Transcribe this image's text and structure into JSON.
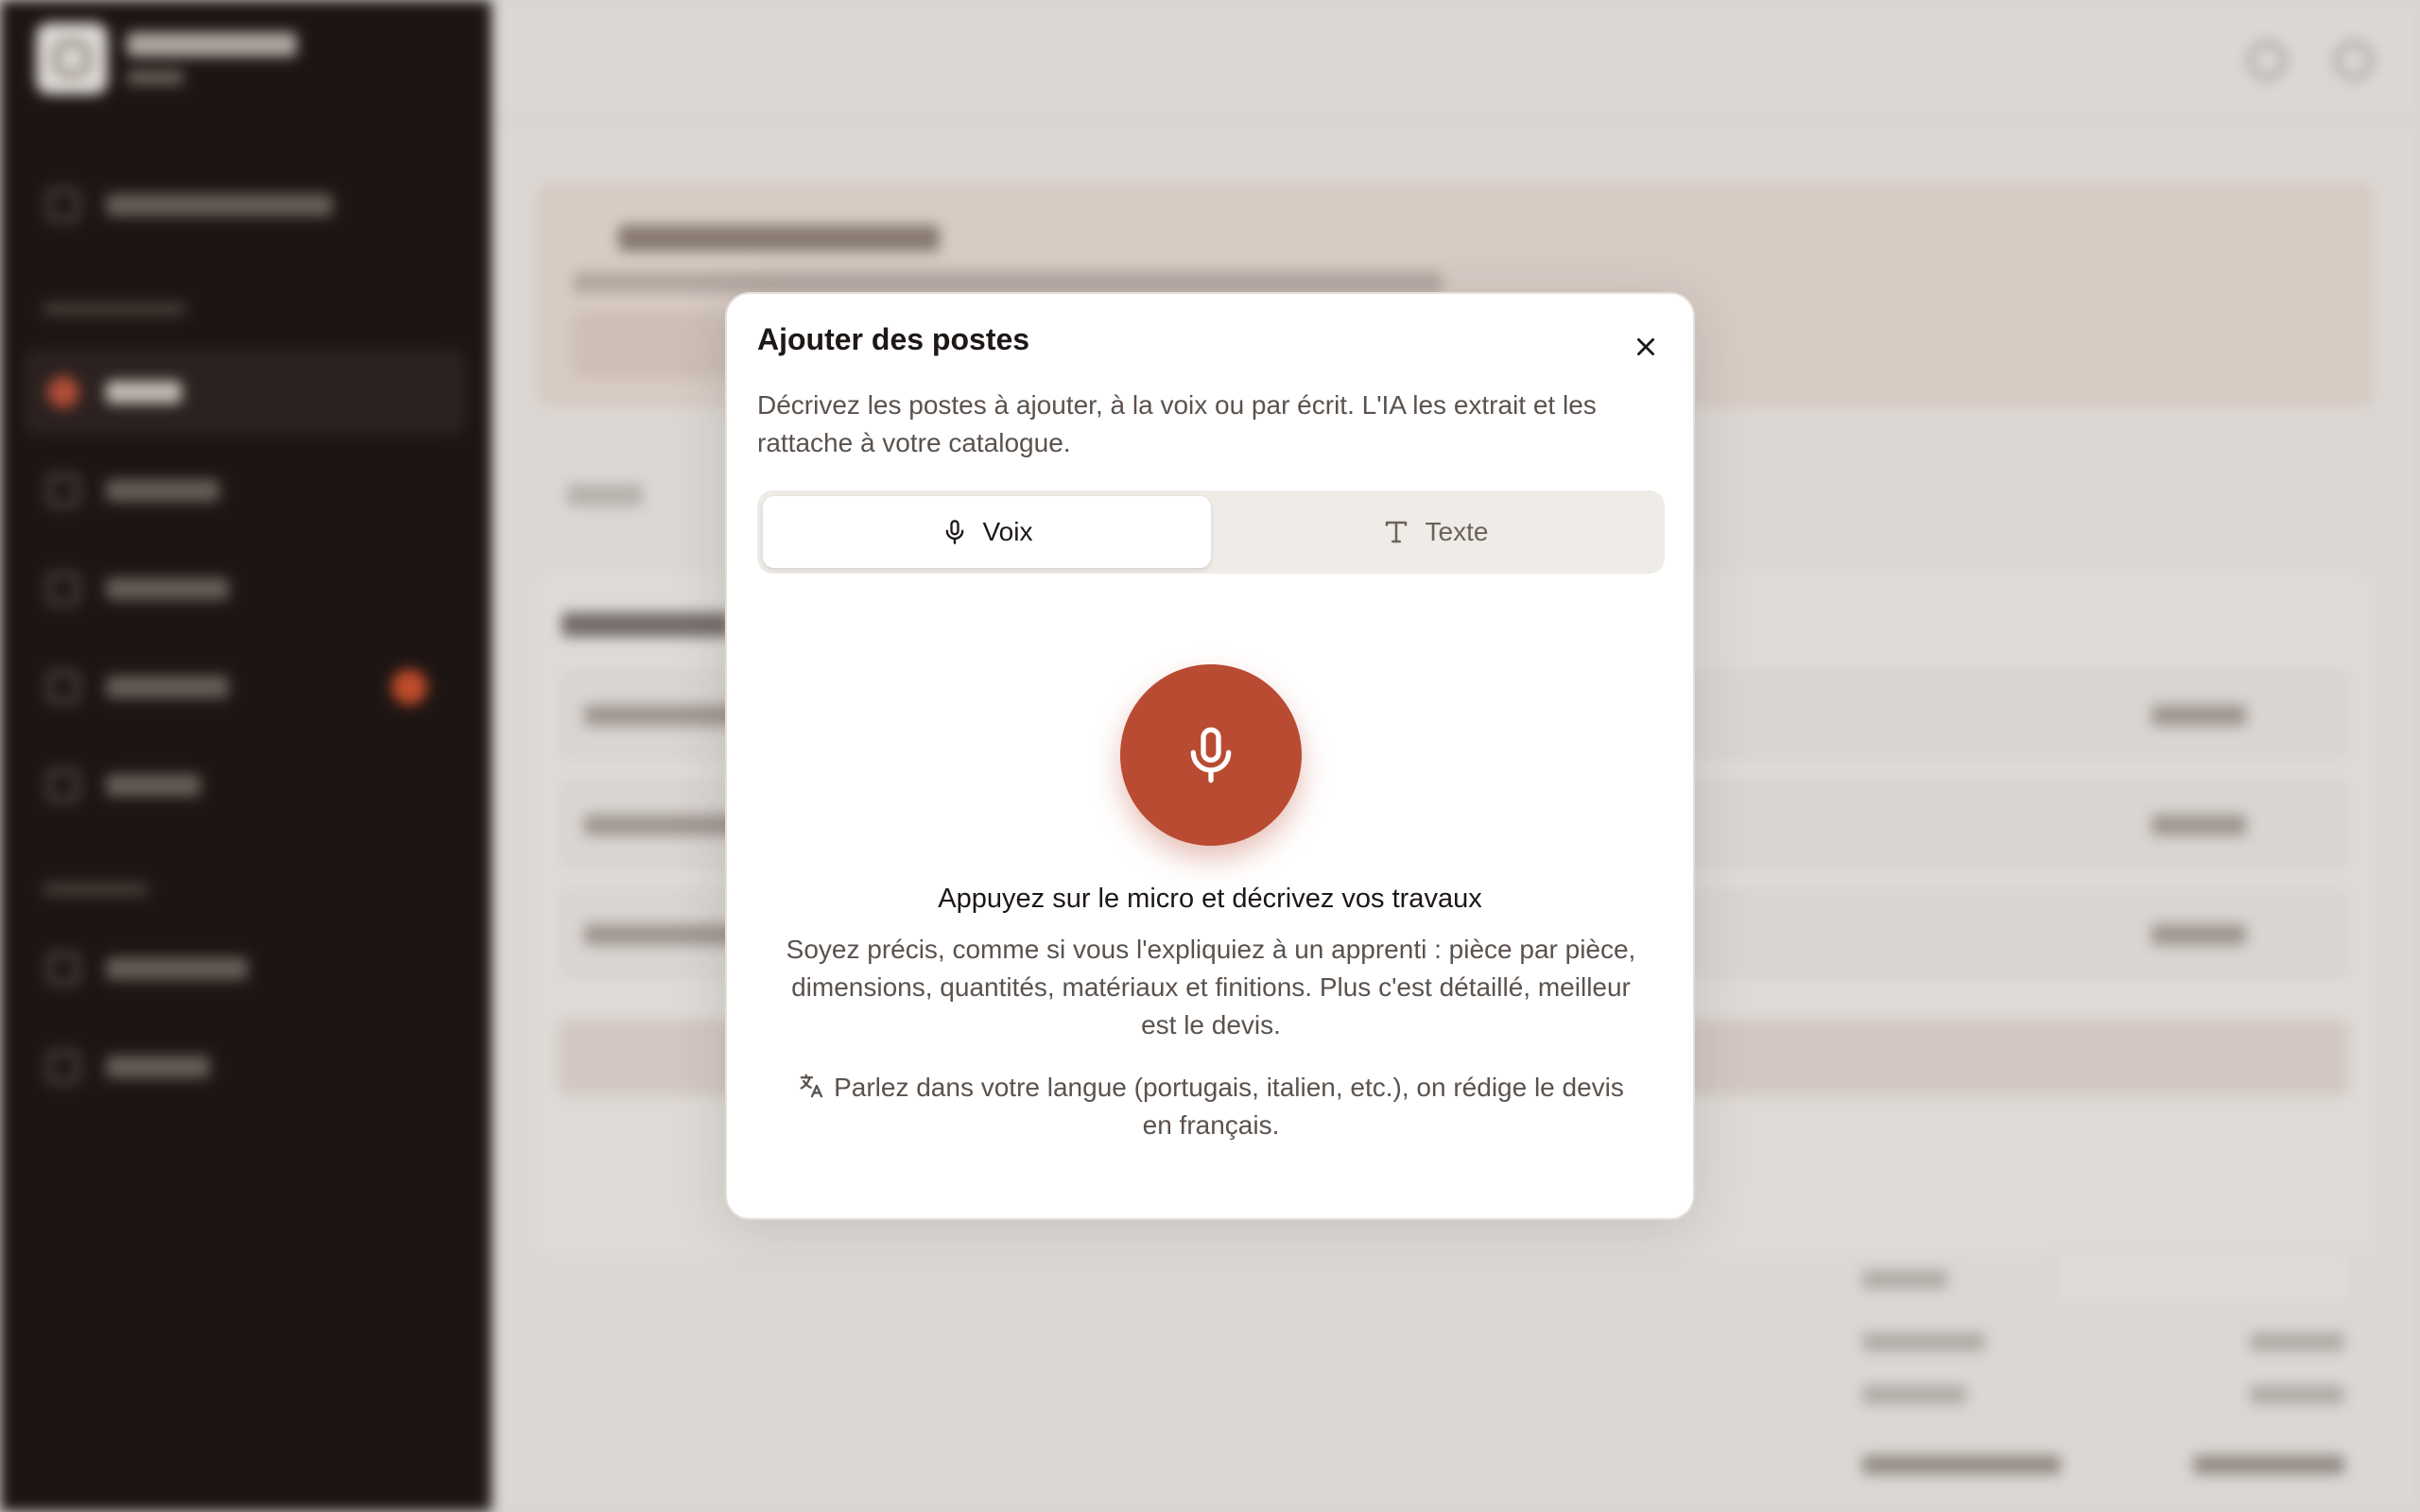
{
  "modal": {
    "title": "Ajouter des postes",
    "description": "Décrivez les postes à ajouter, à la voix ou par écrit. L'IA les extrait et les rattache à votre catalogue.",
    "tabs": [
      {
        "label": "Voix",
        "icon": "microphone-icon",
        "active": true
      },
      {
        "label": "Texte",
        "icon": "text-type-icon",
        "active": false
      }
    ],
    "mic_button": {
      "icon": "microphone-icon"
    },
    "prompt": "Appuyez sur le micro et décrivez vos travaux",
    "hint": "Soyez précis, comme si vous l'expliquiez à un apprenti : pièce par pièce, dimensions, quantités, matériaux et finitions. Plus c'est détaillé, meilleur est le devis.",
    "language_note": "Parlez dans votre langue (portugais, italien, etc.), on rédige le devis en français.",
    "language_icon": "translate-icon"
  },
  "colors": {
    "accent": "#b94b32",
    "sidebar_bg": "#1e1614",
    "text_primary": "#1d1715",
    "text_secondary": "#5b524d"
  }
}
